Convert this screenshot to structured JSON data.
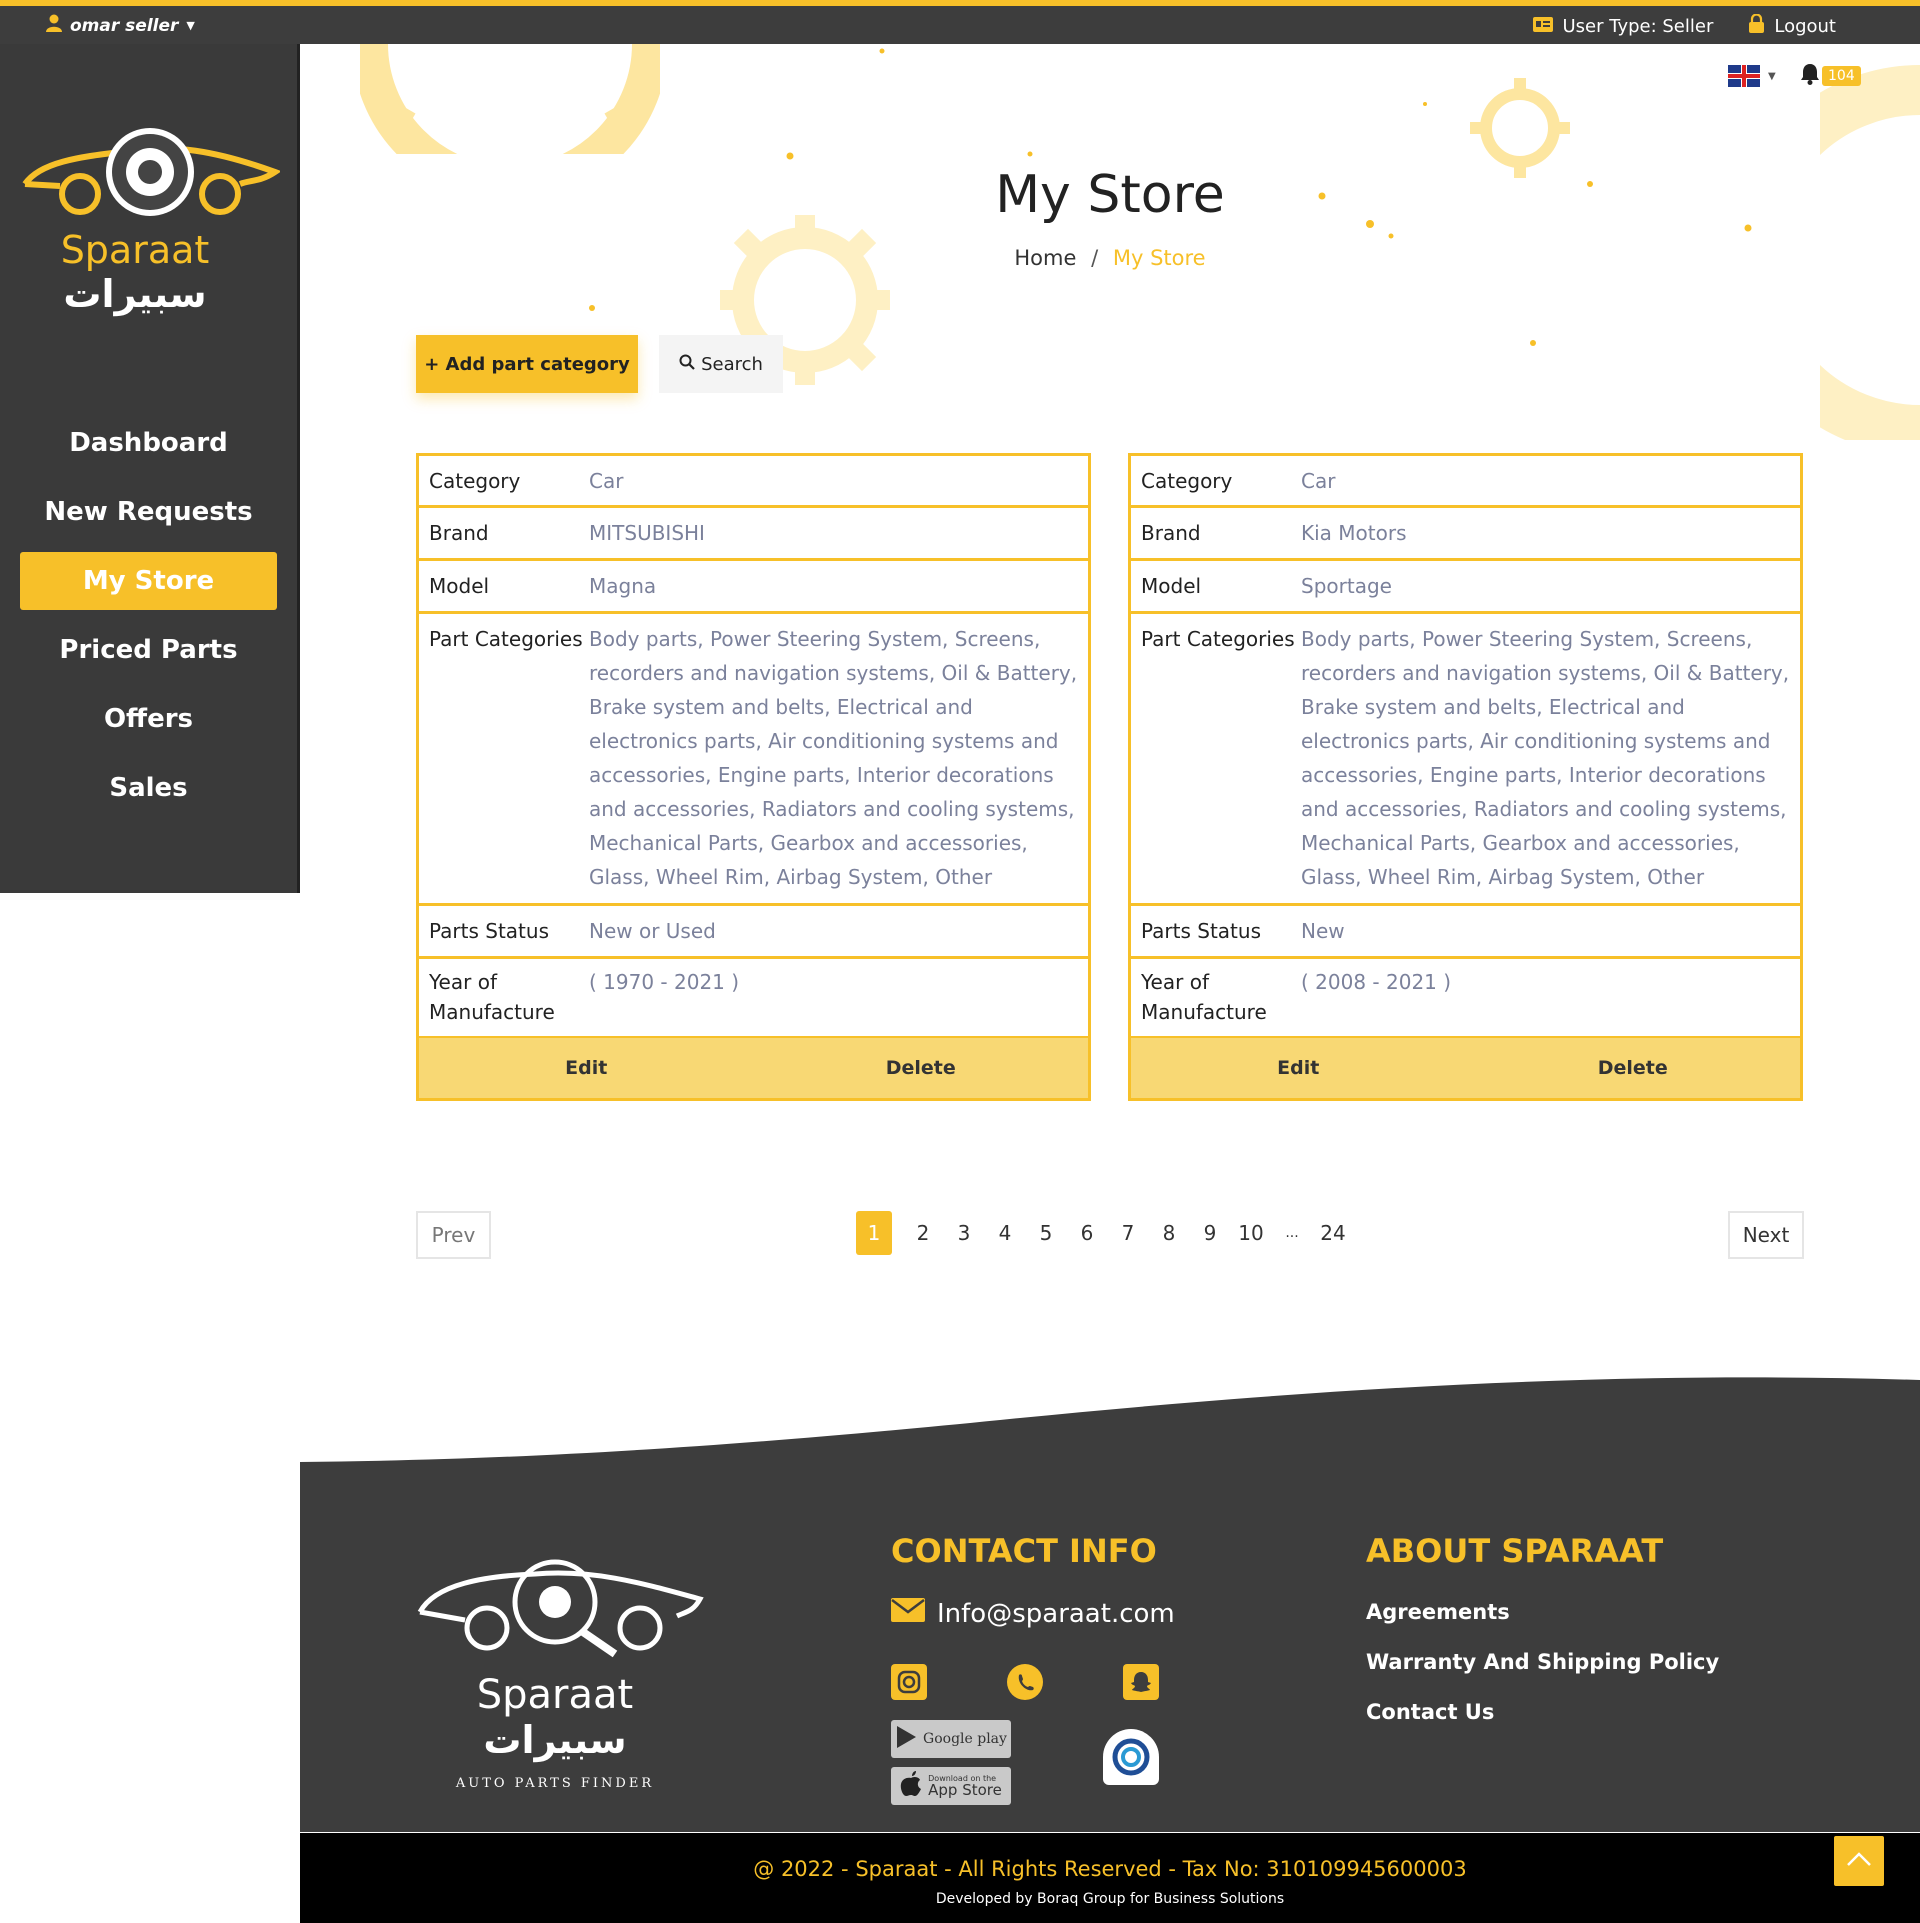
{
  "topbar": {
    "user_name": "omar seller",
    "user_type": "User Type: Seller",
    "logout": "Logout"
  },
  "notifications": {
    "count": "104"
  },
  "sidebar": {
    "brand_en": "Sparaat",
    "brand_ar": "سبيرات",
    "items": [
      {
        "label": "Dashboard",
        "active": false
      },
      {
        "label": "New Requests",
        "active": false
      },
      {
        "label": "My Store",
        "active": true
      },
      {
        "label": "Priced Parts",
        "active": false
      },
      {
        "label": "Offers",
        "active": false
      },
      {
        "label": "Sales",
        "active": false
      }
    ]
  },
  "page": {
    "title": "My Store",
    "breadcrumb_home": "Home",
    "breadcrumb_sep": "/",
    "breadcrumb_current": "My Store"
  },
  "actions": {
    "add_label": "+ Add part category",
    "search_label": "Search"
  },
  "field_labels": {
    "category": "Category",
    "brand": "Brand",
    "model": "Model",
    "part_categories": "Part Categories",
    "parts_status": "Parts Status",
    "year": "Year of Manufacture"
  },
  "cards": [
    {
      "category": "Car",
      "brand": "MITSUBISHI",
      "model": "Magna",
      "part_categories": "Body parts, Power Steering System, Screens, recorders and navigation systems, Oil & Battery, Brake system and belts, Electrical and electronics parts, Air conditioning systems and accessories, Engine parts, Interior decorations and accessories, Radiators and cooling systems, Mechanical Parts, Gearbox and accessories, Glass, Wheel Rim, Airbag System, Other",
      "parts_status": "New or Used",
      "year": "( 1970 - 2021 )",
      "edit": "Edit",
      "delete": "Delete"
    },
    {
      "category": "Car",
      "brand": "Kia Motors",
      "model": "Sportage",
      "part_categories": "Body parts, Power Steering System, Screens, recorders and navigation systems, Oil & Battery, Brake system and belts, Electrical and electronics parts, Air conditioning systems and accessories, Engine parts, Interior decorations and accessories, Radiators and cooling systems, Mechanical Parts, Gearbox and accessories, Glass, Wheel Rim, Airbag System, Other",
      "parts_status": "New",
      "year": "( 2008 - 2021 )",
      "edit": "Edit",
      "delete": "Delete"
    }
  ],
  "pagination": {
    "prev": "Prev",
    "next": "Next",
    "pages": [
      "1",
      "2",
      "3",
      "4",
      "5",
      "6",
      "7",
      "8",
      "9",
      "10",
      "...",
      "24"
    ],
    "current": "1"
  },
  "footer": {
    "logo_en": "Sparaat",
    "logo_ar": "سبيرات",
    "logo_tagline": "AUTO PARTS FINDER",
    "contact_heading": "CONTACT INFO",
    "email": "Info@sparaat.com",
    "google_play": "Google play",
    "app_store_small": "Download on the",
    "app_store": "App Store",
    "about_heading": "ABOUT SPARAAT",
    "links": [
      "Agreements",
      "Warranty And Shipping Policy",
      "Contact Us"
    ],
    "copyright": "@ 2022 - Sparaat - All Rights Reserved - Tax No: 310109945600003",
    "developer": "Developed by Boraq Group for Business Solutions"
  },
  "colors": {
    "accent": "#f7c029",
    "dark": "#3d3d3d",
    "muted_text": "#7b819b"
  }
}
